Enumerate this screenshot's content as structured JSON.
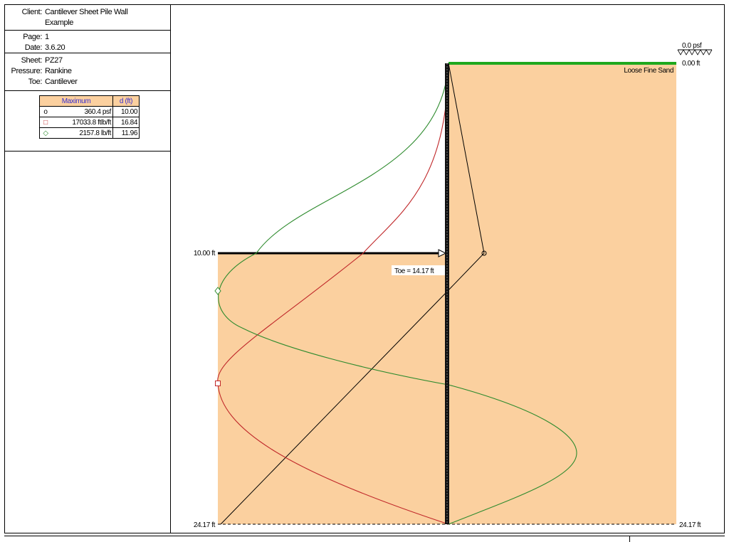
{
  "info": {
    "client_label": "Client:",
    "client_value_line1": "Cantilever Sheet Pile Wall",
    "client_value_line2": "Example",
    "page_label": "Page:",
    "page_value": "1",
    "date_label": "Date:",
    "date_value": "3.6.20",
    "sheet_label": "Sheet:",
    "sheet_value": "PZ27",
    "pressure_label": "Pressure:",
    "pressure_value": "Rankine",
    "toe_label": "Toe:",
    "toe_value": "Cantilever"
  },
  "maxima_table": {
    "col_maximum": "Maximum",
    "col_d": "d (ft)",
    "rows": [
      {
        "marker": "circle-marker-icon",
        "marker_glyph": "o",
        "color": "#000000",
        "value": "360.4 psf",
        "d": "10.00"
      },
      {
        "marker": "square-marker-icon",
        "marker_glyph": "□",
        "color": "#c0282a",
        "value": "17033.8 ftlb/ft",
        "d": "16.84"
      },
      {
        "marker": "diamond-marker-icon",
        "marker_glyph": "◇",
        "color": "#2e8b2e",
        "value": "2157.8 lb/ft",
        "d": "11.96"
      }
    ]
  },
  "diagram": {
    "surcharge_label": "0.0 psf",
    "top_elev_label": "0.00 ft",
    "soil_label": "Loose Fine Sand",
    "excavation_elev_label": "10.00 ft",
    "toe_label": "Toe = 14.17 ft",
    "bottom_elev_left": "24.17 ft",
    "bottom_elev_right": "24.17 ft",
    "colors": {
      "soil": "#fbd09f",
      "ground_line": "#1ea81e",
      "pressure": "#000000",
      "moment": "#c0282a",
      "shear": "#2e8b2e"
    }
  }
}
